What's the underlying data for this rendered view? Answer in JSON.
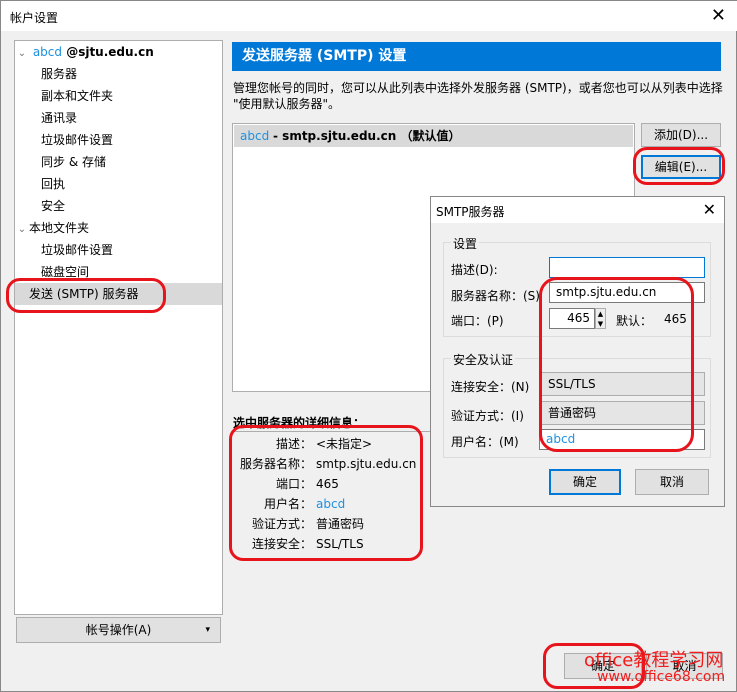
{
  "window": {
    "title": "帐户设置",
    "close": "✕"
  },
  "tree": {
    "account_user": "abcd",
    "account_domain": " @sjtu.edu.cn",
    "items": [
      "服务器",
      "副本和文件夹",
      "通讯录",
      "垃圾邮件设置",
      "同步 & 存储",
      "回执",
      "安全"
    ],
    "local": "本地文件夹",
    "local_items": [
      "垃圾邮件设置",
      "磁盘空间"
    ],
    "smtp": "发送 (SMTP) 服务器"
  },
  "account_actions": "帐号操作(A)",
  "account_actions_arrow": "▾",
  "main": {
    "header": "发送服务器 (SMTP) 设置",
    "description": "管理您帐号的同时，您可以从此列表中选择外发服务器 (SMTP)，或者您也可以从列表中选择 \"使用默认服务器\"。",
    "list_row": {
      "user": "abcd",
      "server": " - smtp.sjtu.edu.cn （默认值）"
    },
    "add": "添加(D)...",
    "edit": "编辑(E)...",
    "details_label": "选中服务器的详细信息：",
    "details": [
      {
        "k": "描述：",
        "v": "<未指定>"
      },
      {
        "k": "服务器名称：",
        "v": "smtp.sjtu.edu.cn"
      },
      {
        "k": "端口：",
        "v": "465"
      },
      {
        "k": "用户名：",
        "v": "abcd"
      },
      {
        "k": "验证方式：",
        "v": "普通密码"
      },
      {
        "k": "连接安全：",
        "v": "SSL/TLS"
      }
    ]
  },
  "dialog": {
    "title": "SMTP服务器",
    "close": "✕",
    "group1": "设置",
    "desc_label": "描述(D):",
    "desc_value": "",
    "server_label": "服务器名称：(S)",
    "server_value": "smtp.sjtu.edu.cn",
    "port_label": "端口：(P)",
    "port_value": "465",
    "default_label": "默认：",
    "default_value": "465",
    "group2": "安全及认证",
    "conn_label": "连接安全：(N)",
    "conn_value": "SSL/TLS",
    "auth_label": "验证方式：(I)",
    "auth_value": "普通密码",
    "user_label": "用户名：(M)",
    "user_value": "abcd",
    "ok": "确定",
    "cancel": "取消"
  },
  "footer": {
    "ok": "确定",
    "cancel": "取消"
  },
  "watermark": {
    "line1": "office教程学习网",
    "line2": "www.office68.com"
  }
}
